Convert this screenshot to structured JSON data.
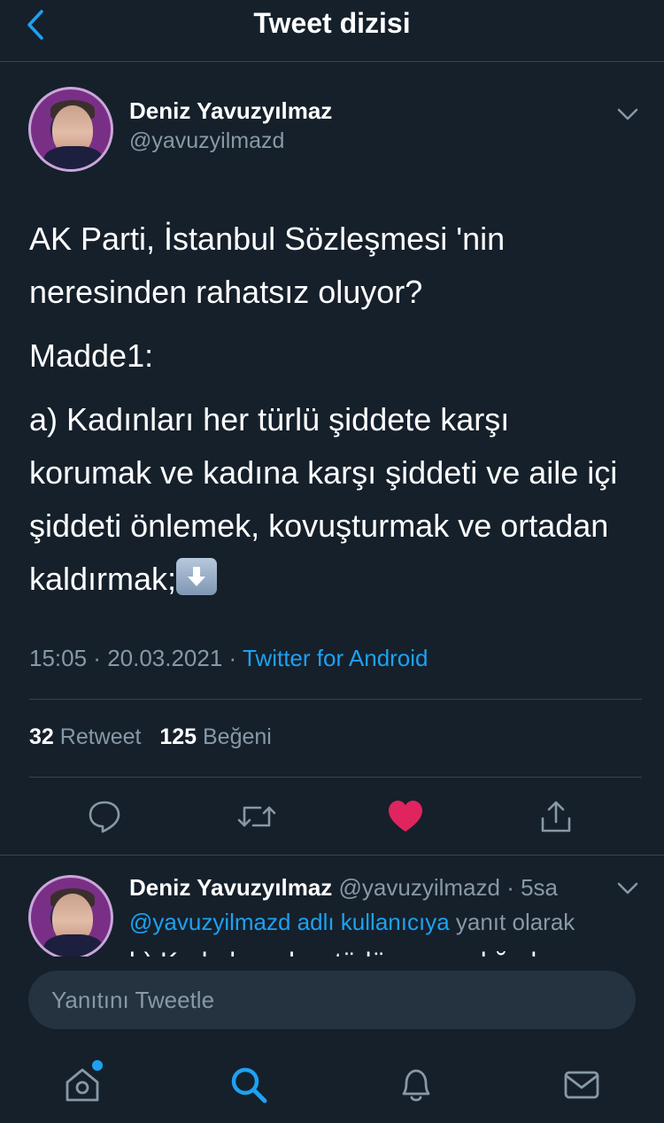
{
  "header": {
    "title": "Tweet dizisi",
    "back_icon": "chevron-left-icon"
  },
  "main_tweet": {
    "author_name": "Deniz Yavuzyılmaz",
    "handle": "@yavuzyilmazd",
    "paragraphs": [
      "AK Parti, İstanbul Sözleşmesi 'nin neresinden rahatsız oluyor?",
      "Madde1:",
      "a) Kadınları her türlü şiddete karşı korumak ve kadına karşı şiddeti ve aile içi şiddeti önlemek, kovuşturmak ve ortadan kaldırmak;"
    ],
    "emoji": "down-arrow-emoji",
    "time": "15:05",
    "date": "20.03.2021",
    "source": "Twitter for Android",
    "retweet_count": "32",
    "retweet_label": "Retweet",
    "like_count": "125",
    "like_label": "Beğeni",
    "liked_color": "#e0245e"
  },
  "reply_tweet": {
    "author_name": "Deniz Yavuzyılmaz",
    "handle": "@yavuzyilmazd",
    "age": "5sa",
    "reply_mention": "@yavuzyilmazd adlı kullanıcıya",
    "reply_suffix": "yanıt olarak",
    "clipped_text": "b) Kadınların her türlü ayrımcılığa karşı"
  },
  "compose": {
    "placeholder": "Yanıtını Tweetle"
  },
  "tabs": [
    "home-icon",
    "search-icon",
    "notifications-icon",
    "messages-icon"
  ],
  "colors": {
    "background": "#15202b",
    "accent": "#1da1f2",
    "secondary_text": "#8899a6",
    "divider": "#38444d"
  }
}
